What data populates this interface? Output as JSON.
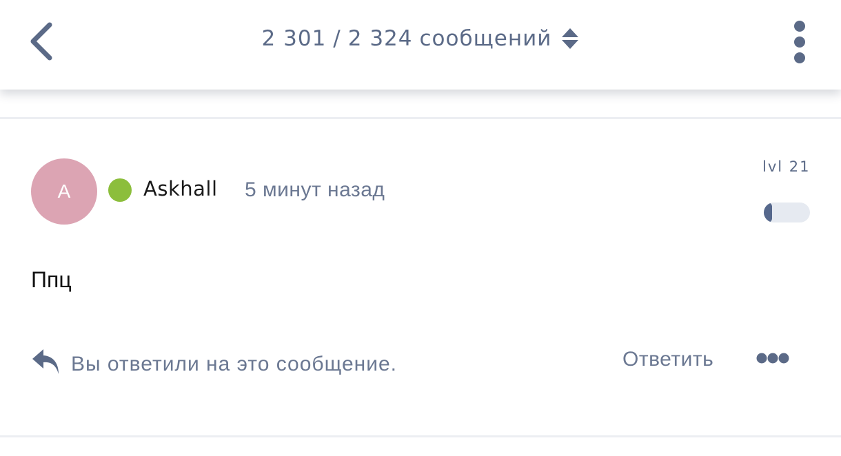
{
  "header": {
    "current": "2 301",
    "separator": "/",
    "total": "2 324",
    "unit": "сообщений",
    "icons": {
      "back": "chevron-left-icon",
      "sort": "sort-up-down-icon",
      "menu": "vertical-dots-icon"
    }
  },
  "message": {
    "avatar_letter": "A",
    "avatar_color": "#dca4b3",
    "online_color": "#8cbe3c",
    "username": "Askhall",
    "timestamp": "5 минут назад",
    "level_label": "lvl 21",
    "level_progress": 0.18,
    "text": "Ппц"
  },
  "footer": {
    "reply_status": "Вы ответили на это сообщение.",
    "reply_label": "Ответить",
    "icons": {
      "reply": "reply-arrow-icon",
      "more": "horizontal-dots-icon"
    }
  },
  "colors": {
    "accent": "#5b6a87",
    "muted_text": "#6b7892",
    "divider": "#eceef2"
  }
}
